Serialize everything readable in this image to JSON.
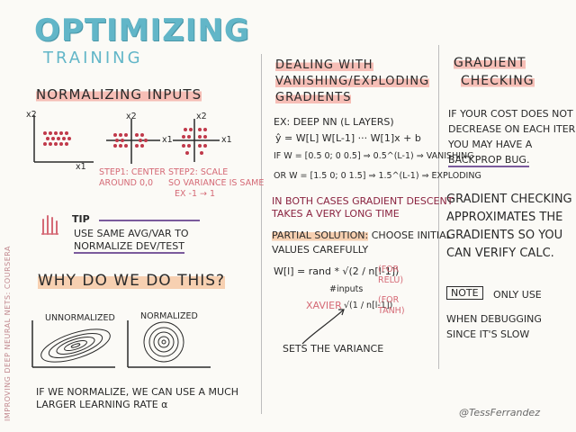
{
  "title": "OPTIMIZING",
  "subtitle": "TRAINING",
  "side_note": "IMPROVING DEEP NEURAL NETS: COURSERA",
  "normalizing": {
    "heading": "NORMALIZING INPUTS",
    "axis_x": "x1",
    "axis_y": "x2",
    "step1": "STEP1: CENTER AROUND 0,0",
    "step1_line1": "STEP1: CENTER",
    "step1_line2": "AROUND 0,0",
    "step2_line1": "STEP2: SCALE",
    "step2_line2": "SO VARIANCE IS SAME",
    "step2_line3": "EX -1 → 1"
  },
  "tip": {
    "label": "TIP",
    "line1": "USE SAME AVG/VAR TO",
    "line2": "NORMALIZE DEV/TEST"
  },
  "why": {
    "heading": "WHY DO WE DO THIS?",
    "unnormalized": "UNNORMALIZED",
    "normalized": "NORMALIZED",
    "line1": "IF WE NORMALIZE, WE CAN USE A MUCH",
    "line2": "LARGER LEARNING RATE α"
  },
  "vanishing": {
    "heading1": "DEALING WITH",
    "heading2": "VANISHING/EXPLODING",
    "heading3": "GRADIENTS",
    "example": "EX: DEEP NN (L LAYERS)",
    "formula": "ŷ = W[L] W[L-1] ··· W[1]x + b",
    "if_line": "IF W = [0.5 0; 0 0.5] ⇒ 0.5^(L-1) ⇒ VANISHING",
    "or_line": "OR W = [1.5 0; 0 1.5] ⇒ 1.5^(L-1) ⇒ EXPLODING",
    "both1": "IN BOTH CASES GRADIENT DESCENT",
    "both2": "TAKES A VERY LONG TIME",
    "partial_label": "PARTIAL SOLUTION:",
    "partial_rest": "CHOOSE INITIAL",
    "partial2": "VALUES CAREFULLY",
    "init_formula": "W[l] = rand * √(2 / n[l-1])",
    "for_relu": "(FOR RELU)",
    "inputs_note": "#inputs",
    "xavier": "XAVIER",
    "xavier_formula": "√(1 / n[l-1])",
    "for_tanh": "(FOR TANH)",
    "sets_variance": "SETS THE VARIANCE"
  },
  "gradient_check": {
    "heading1": "GRADIENT",
    "heading2": "CHECKING",
    "p1_l1": "IF YOUR COST DOES NOT",
    "p1_l2": "DECREASE ON EACH ITER",
    "p1_l3": "YOU MAY HAVE A",
    "p1_l4": "BACKPROP BUG.",
    "p2_l1": "GRADIENT CHECKING",
    "p2_l2": "APPROXIMATES THE",
    "p2_l3": "GRADIENTS SO YOU",
    "p2_l4": "CAN VERIFY CALC.",
    "note_label": "NOTE",
    "note_l1": "ONLY USE",
    "note_l2": "WHEN DEBUGGING",
    "note_l3": "SINCE IT'S SLOW"
  },
  "signature": "@TessFerrandez",
  "colors": {
    "title": "#62b6c8",
    "highlight_pink": "#f4aaa0",
    "highlight_orange": "#f6c6a0",
    "accent_pink": "#d56a76",
    "maroon": "#8a2340",
    "purple": "#7a5a9c"
  }
}
